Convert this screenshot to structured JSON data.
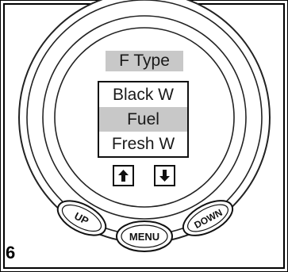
{
  "screen": {
    "title": "F Type",
    "menu_items": [
      {
        "label": "Black W",
        "selected": false
      },
      {
        "label": "Fuel",
        "selected": true
      },
      {
        "label": "Fresh W",
        "selected": false
      }
    ]
  },
  "buttons": {
    "up_label": "UP",
    "menu_label": "MENU",
    "down_label": "DOWN"
  },
  "figure_number": "6",
  "icons": {
    "up_arrow": "arrow-up-icon",
    "down_arrow": "arrow-down-icon"
  },
  "colors": {
    "highlight": "#c8c8c8",
    "outline": "#111111"
  }
}
